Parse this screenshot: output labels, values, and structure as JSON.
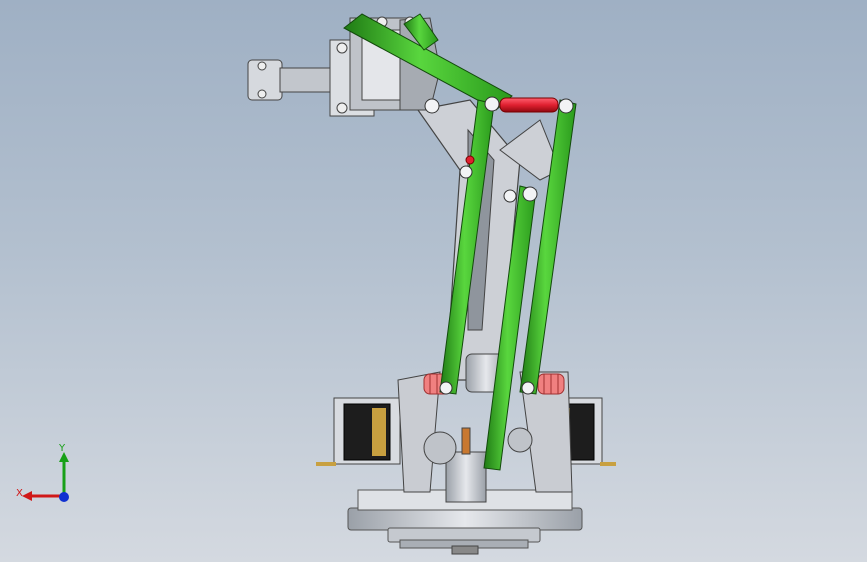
{
  "scene": {
    "background_top": "#9fb0c4",
    "background_bottom": "#d4d9e0",
    "model": "robotic-arm-assembly"
  },
  "colors": {
    "link_green": "#3fbf2a",
    "link_green_dark": "#1f7a14",
    "pin_red": "#e02030",
    "metal": "#cfd3d9",
    "metal_dark": "#8a9098",
    "servo_black": "#1d1d1d",
    "servo_label": "#c8a040"
  },
  "triad": {
    "x_label": "X",
    "y_label": "Y",
    "x_color": "#d01818",
    "y_color": "#18a018",
    "z_color": "#1030d0"
  }
}
